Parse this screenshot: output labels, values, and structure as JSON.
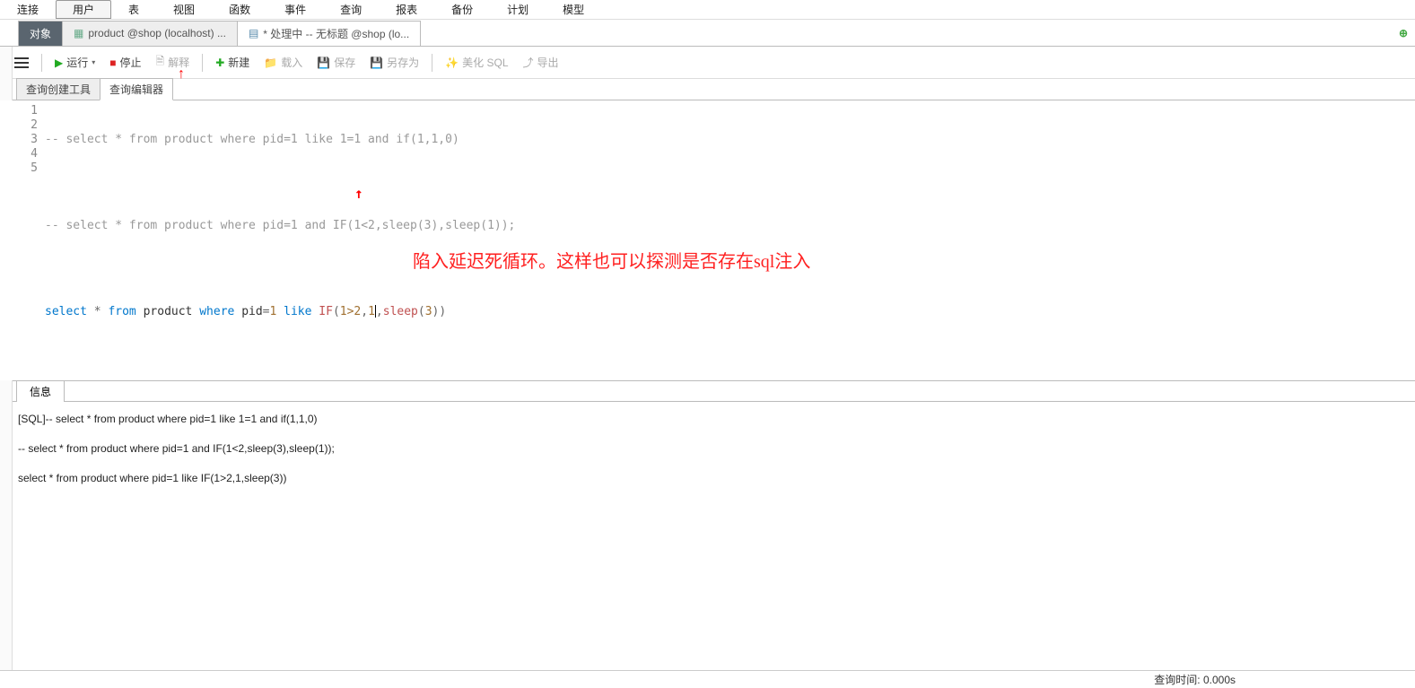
{
  "menu": {
    "items": [
      "连接",
      "用户",
      "表",
      "视图",
      "函数",
      "事件",
      "查询",
      "报表",
      "备份",
      "计划",
      "模型"
    ],
    "active_index": 1
  },
  "tabs": {
    "obj": "对象",
    "items": [
      {
        "label": "product @shop (localhost) ...",
        "icon": "table"
      },
      {
        "label": "* 处理中 -- 无标题 @shop (lo...",
        "icon": "query"
      }
    ]
  },
  "toolbar": {
    "run": "运行",
    "stop": "停止",
    "explain": "解释",
    "new": "新建",
    "load": "载入",
    "save": "保存",
    "saveas": "另存为",
    "beautify": "美化 SQL",
    "export": "导出"
  },
  "subtabs": {
    "builder": "查询创建工具",
    "editor": "查询编辑器"
  },
  "editor": {
    "lines": [
      {
        "n": "1",
        "type": "comment",
        "text": "-- select * from product where pid=1 like 1=1 and if(1,1,0)"
      },
      {
        "n": "2",
        "type": "blank",
        "text": ""
      },
      {
        "n": "3",
        "type": "comment",
        "text": "-- select * from product where pid=1 and IF(1<2,sleep(3),sleep(1));"
      },
      {
        "n": "4",
        "type": "blank",
        "text": ""
      },
      {
        "n": "5",
        "type": "sql",
        "tokens": {
          "select": "select",
          "star": "*",
          "from": "from",
          "product": "product",
          "where": "where",
          "pid": "pid",
          "eq": "=",
          "one": "1",
          "like": "like",
          "if": "IF",
          "lp": "(",
          "cond": "1>2",
          "c1": ",",
          "arg2": "1",
          "c2": ",",
          "sleep": "sleep",
          "lp2": "(",
          "three": "3",
          "rp2": ")",
          "rp": ")"
        }
      }
    ]
  },
  "annotations": {
    "text": "陷入延迟死循环。这样也可以探测是否存在sql注入"
  },
  "result": {
    "tab_label": "信息",
    "lines": [
      "[SQL]-- select * from product where pid=1 like 1=1 and if(1,1,0)",
      "-- select * from product where pid=1 and IF(1<2,sleep(3),sleep(1));",
      "select * from product where pid=1 like IF(1>2,1,sleep(3))"
    ]
  },
  "status": {
    "query_time": "查询时间: 0.000s"
  }
}
